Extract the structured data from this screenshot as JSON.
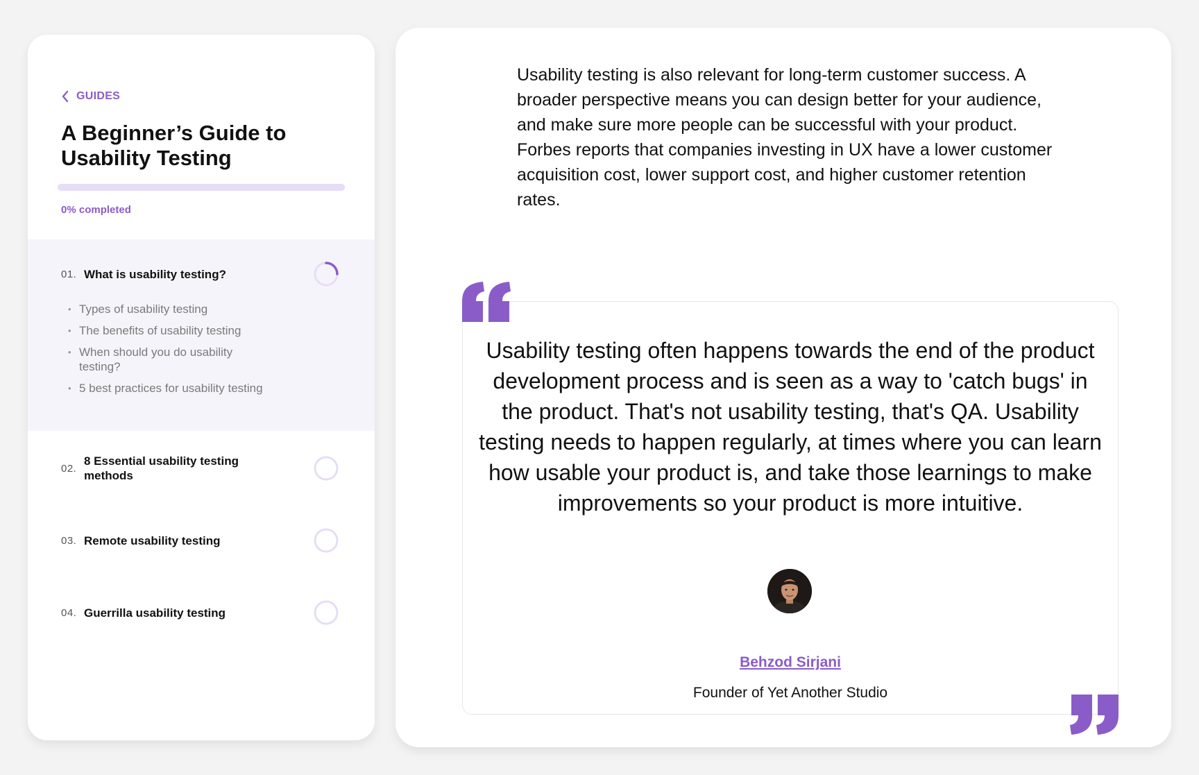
{
  "sidebar": {
    "back_label": "GUIDES",
    "title": "A Beginner’s Guide to Usability Testing",
    "progress_fraction": 0.0,
    "progress_text": "0% completed",
    "chapters": [
      {
        "number": "01.",
        "title": "What is usability testing?",
        "state": "in-progress",
        "progress_fraction": 0.25,
        "sections": [
          "Types of usability testing",
          "The benefits of usability testing",
          "When should you do usability testing?",
          "5 best practices for usability testing"
        ]
      },
      {
        "number": "02.",
        "title": "8 Essential usability testing methods",
        "state": "not-started",
        "progress_fraction": 0.0
      },
      {
        "number": "03.",
        "title": "Remote usability testing",
        "state": "not-started",
        "progress_fraction": 0.0
      },
      {
        "number": "04.",
        "title": "Guerrilla usability testing",
        "state": "not-started",
        "progress_fraction": 0.0
      }
    ]
  },
  "main": {
    "intro": "Usability testing is also relevant for long-term customer success. A broader perspective means you can design better for your audience, and make sure more people can be successful with your product. Forbes reports that companies investing in UX have a lower customer acquisition cost, lower support cost, and higher customer retention rates.",
    "quote": {
      "text": "Usability testing often happens towards the end of the product development process and is seen as a way to 'catch bugs' in the product. That's not usability testing, that's QA. Usability testing needs to happen regularly, at times where you can learn how usable your product is, and take those learnings to make improvements so your product is more intuitive.",
      "author_name": "Behzod Sirjani",
      "author_role": "Founder of Yet Another Studio",
      "avatar_icon": "person-photo"
    }
  },
  "colors": {
    "accent": "#8a5cc8",
    "accent_light": "#e6ddf6",
    "active_row_bg": "#f6f4fb",
    "page_bg": "#f3f3f3"
  },
  "icons": {
    "back": "chevron-left-icon",
    "quote_open": "open-quote-icon",
    "quote_close": "close-quote-icon",
    "chapter_status": "progress-ring-icon"
  }
}
